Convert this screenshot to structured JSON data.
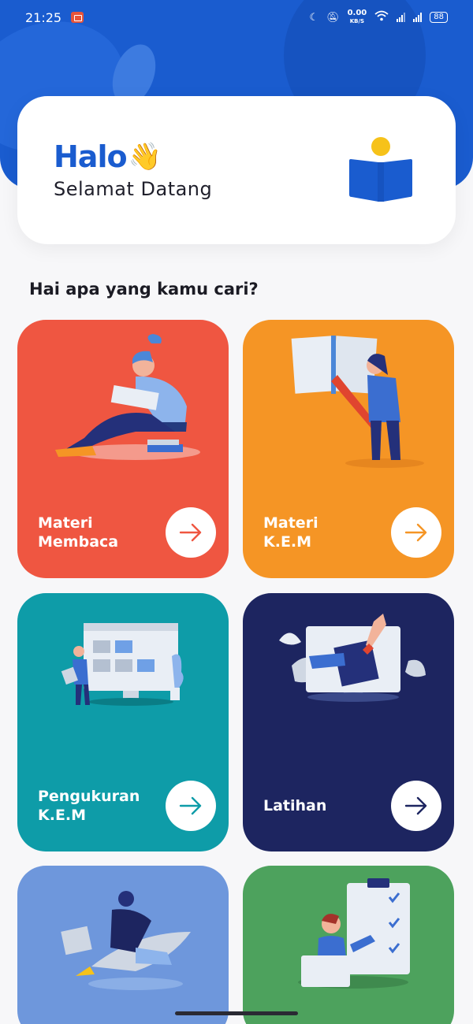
{
  "status_bar": {
    "time": "21:25",
    "speed_value": "0.00",
    "speed_unit": "KB/S",
    "battery": "88"
  },
  "welcome": {
    "greeting": "Halo",
    "greeting_emoji": "👋",
    "subtitle": "Selamat Datang"
  },
  "section_title": "Hai apa yang kamu cari?",
  "menu": [
    {
      "label": "Materi\nMembaca",
      "color": "#ef5641",
      "arrow_color": "#ef5641"
    },
    {
      "label": "Materi\nK.E.M",
      "color": "#f59525",
      "arrow_color": "#f59525"
    },
    {
      "label": "Pengukuran\nK.E.M",
      "color": "#0e9ca8",
      "arrow_color": "#0e9ca8"
    },
    {
      "label": "Latihan",
      "color": "#1d2560",
      "arrow_color": "#1d2560"
    },
    {
      "label": "",
      "color": "#6e97dc"
    },
    {
      "label": "",
      "color": "#4da25d"
    }
  ],
  "colors": {
    "primary": "#1a5ccf",
    "accent_yellow": "#f6c21a"
  }
}
